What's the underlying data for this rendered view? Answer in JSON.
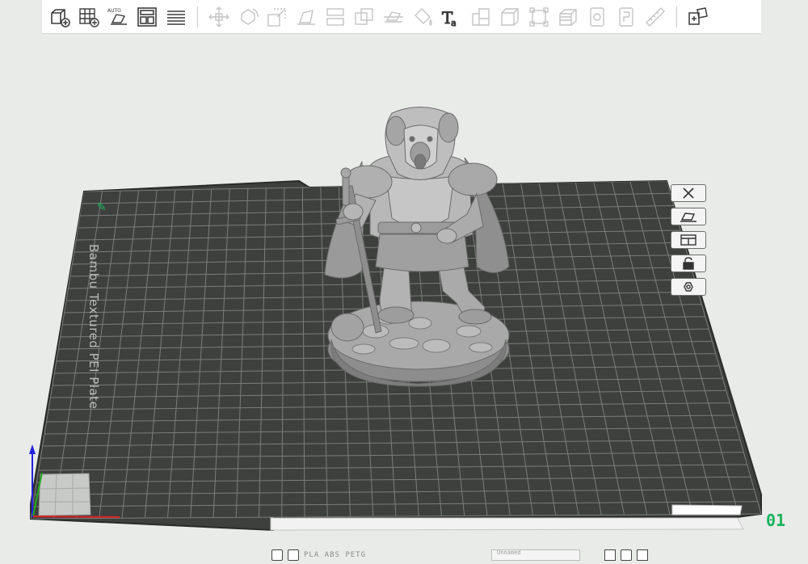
{
  "toolbar": {
    "items": [
      {
        "icon": "add-object-icon",
        "active": true
      },
      {
        "icon": "add-plate-icon",
        "active": true
      },
      {
        "icon": "auto-orient-icon",
        "active": true,
        "label": "AUTO"
      },
      {
        "icon": "arrange-icon",
        "active": true
      },
      {
        "icon": "slice-layers-icon",
        "active": true
      },
      {
        "icon": "move-icon",
        "active": false
      },
      {
        "icon": "rotate-icon",
        "active": false
      },
      {
        "icon": "scale-icon",
        "active": false
      },
      {
        "icon": "lay-on-face-icon",
        "active": false
      },
      {
        "icon": "split-objects-icon",
        "active": false
      },
      {
        "icon": "split-parts-icon",
        "active": false
      },
      {
        "icon": "cut-icon",
        "active": false
      },
      {
        "icon": "paint-icon",
        "active": false
      },
      {
        "icon": "text-icon",
        "active": true,
        "label": "Ta"
      },
      {
        "icon": "mesh-boolean-icon",
        "active": false
      },
      {
        "icon": "measure-icon",
        "active": false
      },
      {
        "icon": "support-paint-icon",
        "active": false
      },
      {
        "icon": "seam-paint-icon",
        "active": false
      },
      {
        "icon": "variable-layer-icon",
        "active": false
      },
      {
        "icon": "ruler-icon",
        "active": false
      },
      {
        "icon": "assembly-icon",
        "active": true
      }
    ]
  },
  "plate": {
    "name": "Bambu Textured PEI Plate",
    "number": "01",
    "slot_text": "PLA ABS PETG",
    "info_text": "Unnamed"
  },
  "colors": {
    "plate": "#3e403e",
    "grid": "#7a7d7a",
    "accent": "#19b35a",
    "model": "#9a9a9a"
  },
  "plate_tools": [
    {
      "icon": "close-icon"
    },
    {
      "icon": "orient-plate-icon"
    },
    {
      "icon": "arrange-plate-icon"
    },
    {
      "icon": "lock-icon"
    },
    {
      "icon": "settings-icon"
    }
  ]
}
